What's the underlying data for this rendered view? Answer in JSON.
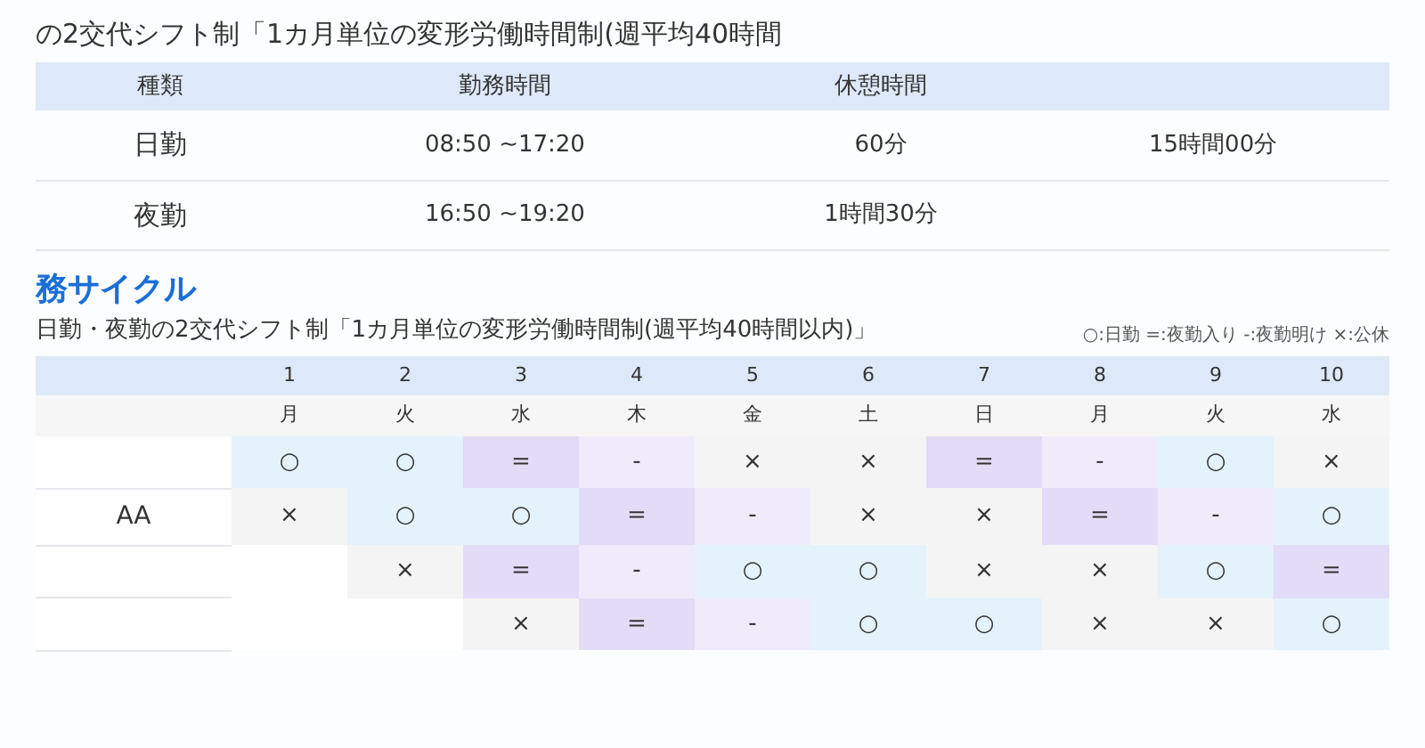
{
  "shift_section": {
    "subtitle": "の2交代シフト制「1カ月単位の変形労働時間制(週平均40時間",
    "columns": [
      "種類",
      "勤務時間",
      "休憩時間",
      null
    ],
    "rows": [
      {
        "cells": [
          "日勤",
          "08:50 ~17:20",
          "60分",
          "15時間00分"
        ]
      },
      {
        "cells": [
          "夜勤",
          "16:50 ~19:20",
          "1時間30分",
          null
        ]
      }
    ]
  },
  "cycle_section": {
    "heading": "務サイクル",
    "subtitle": "日勤・夜勤の2交代シフト制「1カ月単位の変形労働時間制(週平均40時間以内)」",
    "legend": "○:日勤 =:夜勤入り -:夜勤明け ×:公休",
    "days": [
      "1",
      "2",
      "3",
      "4",
      "5",
      "6",
      "7",
      "8",
      "9",
      "10"
    ],
    "weekdays": [
      "月",
      "火",
      "水",
      "木",
      "金",
      "土",
      "日",
      "月",
      "火",
      "水"
    ],
    "rows": [
      {
        "label": null,
        "cells": [
          {
            "kind": "day",
            "mark": "○"
          },
          {
            "kind": "day",
            "mark": "○"
          },
          {
            "kind": "night_in",
            "mark": "="
          },
          {
            "kind": "night_out",
            "mark": "-"
          },
          {
            "kind": "off",
            "mark": "×"
          },
          {
            "kind": "off",
            "mark": "×"
          },
          {
            "kind": "night_in",
            "mark": "="
          },
          {
            "kind": "night_out",
            "mark": "-"
          },
          {
            "kind": "day",
            "mark": "○"
          },
          {
            "kind": "off",
            "mark": "×"
          }
        ]
      },
      {
        "label": "AA",
        "cells": [
          {
            "kind": "off",
            "mark": "×"
          },
          {
            "kind": "day",
            "mark": "○"
          },
          {
            "kind": "day",
            "mark": "○"
          },
          {
            "kind": "night_in",
            "mark": "="
          },
          {
            "kind": "night_out",
            "mark": "-"
          },
          {
            "kind": "off",
            "mark": "×"
          },
          {
            "kind": "off",
            "mark": "×"
          },
          {
            "kind": "night_in",
            "mark": "="
          },
          {
            "kind": "night_out",
            "mark": "-"
          },
          {
            "kind": "day",
            "mark": "○"
          }
        ]
      },
      {
        "label": null,
        "cells": [
          null,
          {
            "kind": "off",
            "mark": "×"
          },
          {
            "kind": "night_in",
            "mark": "="
          },
          {
            "kind": "night_out",
            "mark": "-"
          },
          {
            "kind": "day",
            "mark": "○"
          },
          {
            "kind": "day",
            "mark": "○"
          },
          {
            "kind": "off",
            "mark": "×"
          },
          {
            "kind": "off",
            "mark": "×"
          },
          {
            "kind": "day",
            "mark": "○"
          },
          {
            "kind": "night_in",
            "mark": "="
          }
        ]
      },
      {
        "label": null,
        "cells": [
          null,
          null,
          {
            "kind": "off",
            "mark": "×"
          },
          {
            "kind": "night_in",
            "mark": "="
          },
          {
            "kind": "night_out",
            "mark": "-"
          },
          {
            "kind": "day",
            "mark": "○"
          },
          {
            "kind": "day",
            "mark": "○"
          },
          {
            "kind": "off",
            "mark": "×"
          },
          {
            "kind": "off",
            "mark": "×"
          },
          {
            "kind": "day",
            "mark": "○"
          }
        ]
      }
    ]
  }
}
